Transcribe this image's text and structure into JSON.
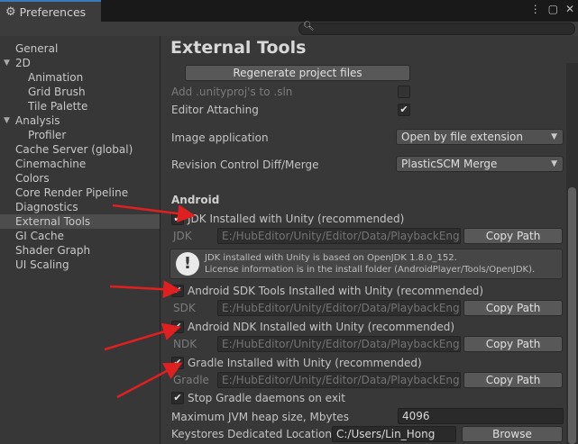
{
  "window": {
    "tab_title": "Preferences",
    "controls": [
      "⋮",
      "▢",
      "✕"
    ]
  },
  "search": {
    "placeholder": ""
  },
  "sidebar": {
    "items": [
      {
        "label": "General",
        "level": 0
      },
      {
        "label": "2D",
        "level": 0,
        "expanded": true
      },
      {
        "label": "Animation",
        "level": 1
      },
      {
        "label": "Grid Brush",
        "level": 1
      },
      {
        "label": "Tile Palette",
        "level": 1
      },
      {
        "label": "Analysis",
        "level": 0,
        "expanded": true
      },
      {
        "label": "Profiler",
        "level": 1
      },
      {
        "label": "Cache Server (global)",
        "level": 0
      },
      {
        "label": "Cinemachine",
        "level": 0
      },
      {
        "label": "Colors",
        "level": 0
      },
      {
        "label": "Core Render Pipeline",
        "level": 0
      },
      {
        "label": "Diagnostics",
        "level": 0
      },
      {
        "label": "External Tools",
        "level": 0,
        "selected": true
      },
      {
        "label": "GI Cache",
        "level": 0
      },
      {
        "label": "Shader Graph",
        "level": 0
      },
      {
        "label": "UI Scaling",
        "level": 0
      }
    ]
  },
  "main": {
    "title": "External Tools",
    "regenerate_button": "Regenerate project files",
    "add_unityproj_label": "Add .unityproj's to .sln",
    "editor_attaching_label": "Editor Attaching",
    "editor_attaching_checked": true,
    "image_application_label": "Image application",
    "image_application_value": "Open by file extension",
    "revision_control_label": "Revision Control Diff/Merge",
    "revision_control_value": "PlasticSCM Merge",
    "android": {
      "section_title": "Android",
      "jdk_checkbox_label": "JDK Installed with Unity (recommended)",
      "jdk_label": "JDK",
      "jdk_path": "E:/HubEditor/Unity/Editor/Data/PlaybackEngines/AndroidPlayer/OpenJDK",
      "copy_path": "Copy Path",
      "help_line1": "JDK installed with Unity is based on OpenJDK 1.8.0_152.",
      "help_line2": "License information is in the install folder (AndroidPlayer/Tools/OpenJDK).",
      "sdk_checkbox_label": "Android SDK Tools Installed with Unity (recommended)",
      "sdk_label": "SDK",
      "sdk_path": "E:/HubEditor/Unity/Editor/Data/PlaybackEngines/AndroidPlayer/SDK",
      "ndk_checkbox_label": "Android NDK Installed with Unity (recommended)",
      "ndk_label": "NDK",
      "ndk_path": "E:/HubEditor/Unity/Editor/Data/PlaybackEngines/AndroidPlayer/NDK",
      "gradle_checkbox_label": "Gradle Installed with Unity (recommended)",
      "gradle_label": "Gradle",
      "gradle_path": "E:/HubEditor/Unity/Editor/Data/PlaybackEngines/AndroidPlayer/Tools/gradle",
      "stop_gradle_label": "Stop Gradle daemons on exit",
      "jvm_heap_label": "Maximum JVM heap size, Mbytes",
      "jvm_heap_value": "4096",
      "keystores_label": "Keystores Dedicated Location",
      "keystores_value": "C:/Users/Lin_Hong",
      "browse_button": "Browse"
    }
  },
  "annotation_color": "#e02020"
}
